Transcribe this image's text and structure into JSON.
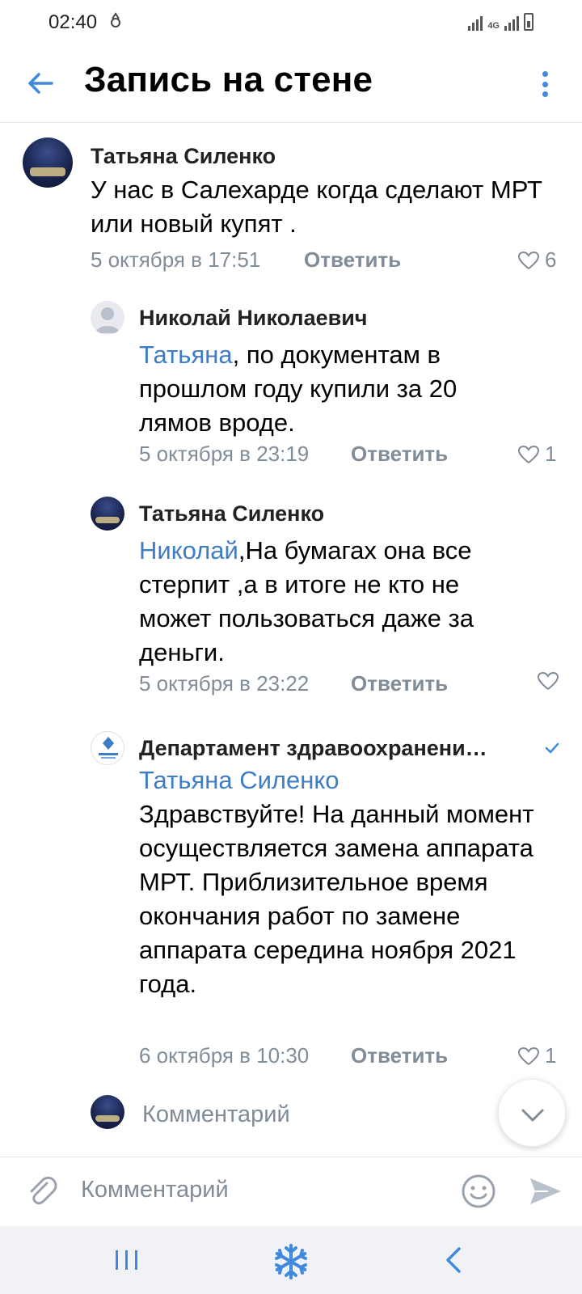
{
  "status_bar": {
    "time": "02:40",
    "network": "4G"
  },
  "app_bar": {
    "title": "Запись на стене",
    "back_icon": "arrow-left-icon",
    "more_icon": "more-vertical-icon"
  },
  "comments": [
    {
      "author": "Татьяна Силенко",
      "mention": "",
      "text": "У нас в Салехарде когда сделают МРТ или новый купят .",
      "date": "5 октября в 17:51",
      "reply_label": "Ответить",
      "likes": "6"
    },
    {
      "author": "Николай Николаевич",
      "mention": "Татьяна",
      "text": ", по документам в прошлом году купили за 20 лямов вроде.",
      "date": "5 октября в 23:19",
      "reply_label": "Ответить",
      "likes": "1"
    },
    {
      "author": "Татьяна Силенко",
      "mention": "Николай",
      "text": ",На бумагах  она все стерпит ,а в итоге не кто не может пользоваться даже за деньги.",
      "date": "5 октября в 23:22",
      "reply_label": "Ответить",
      "likes": ""
    },
    {
      "author": "Департамент здравоохранени…",
      "mention": "Татьяна Силенко",
      "text": "Здравствуйте! На данный момент осуществляется замена аппарата МРТ. Приблизительное время окончания работ по замене аппарата середина ноября 2021 года.",
      "date": "6 октября в 10:30",
      "reply_label": "Ответить",
      "likes": "1"
    }
  ],
  "reply_row": {
    "placeholder": "Комментарий"
  },
  "composer": {
    "placeholder": "Комментарий"
  },
  "colors": {
    "accent": "#3f8ae0",
    "mention": "#3f7cc6",
    "secondary_text": "#818c99",
    "nav_bar_bg": "#f1f2f6"
  }
}
